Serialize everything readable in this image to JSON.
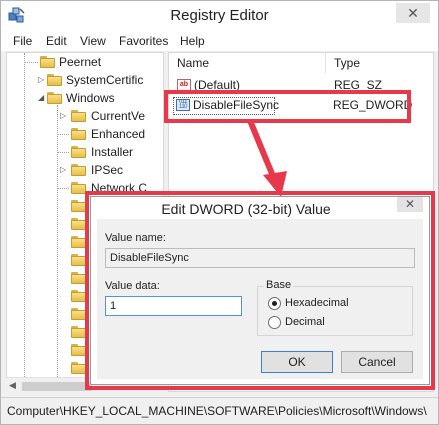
{
  "window": {
    "title": "Registry Editor",
    "close_glyph": "✕"
  },
  "menu": [
    "File",
    "Edit",
    "View",
    "Favorites",
    "Help"
  ],
  "tree": {
    "items": [
      {
        "label": "Peernet",
        "expander": ""
      },
      {
        "label": "SystemCertific",
        "expander": "▷"
      },
      {
        "label": "Windows",
        "expander": "◢"
      },
      {
        "label": "CurrentVe",
        "expander": "▷"
      },
      {
        "label": "Enhanced",
        "expander": ""
      },
      {
        "label": "Installer",
        "expander": ""
      },
      {
        "label": "IPSec",
        "expander": "▷"
      },
      {
        "label": "Network C",
        "expander": ""
      }
    ]
  },
  "list": {
    "columns": [
      "Name",
      "Type"
    ],
    "rows": [
      {
        "icon": "string-value-icon",
        "icon_text": "ab",
        "name": "(Default)",
        "type": "REG_SZ"
      },
      {
        "icon": "binary-value-icon",
        "icon_text": "011 110",
        "name": "DisableFileSync",
        "type": "REG_DWORD"
      }
    ]
  },
  "dialog": {
    "title": "Edit DWORD (32-bit) Value",
    "close_glyph": "✕",
    "value_name_label": "Value name:",
    "value_name": "DisableFileSync",
    "value_data_label": "Value data:",
    "value_data": "1",
    "base_label": "Base",
    "base_options": [
      {
        "label": "Hexadecimal",
        "checked": true
      },
      {
        "label": "Decimal",
        "checked": false
      }
    ],
    "ok_label": "OK",
    "cancel_label": "Cancel"
  },
  "status": {
    "path": "Computer\\HKEY_LOCAL_MACHINE\\SOFTWARE\\Policies\\Microsoft\\Windows\\"
  },
  "colors": {
    "highlight": "#e8394c",
    "folder": "#e7be4b"
  }
}
